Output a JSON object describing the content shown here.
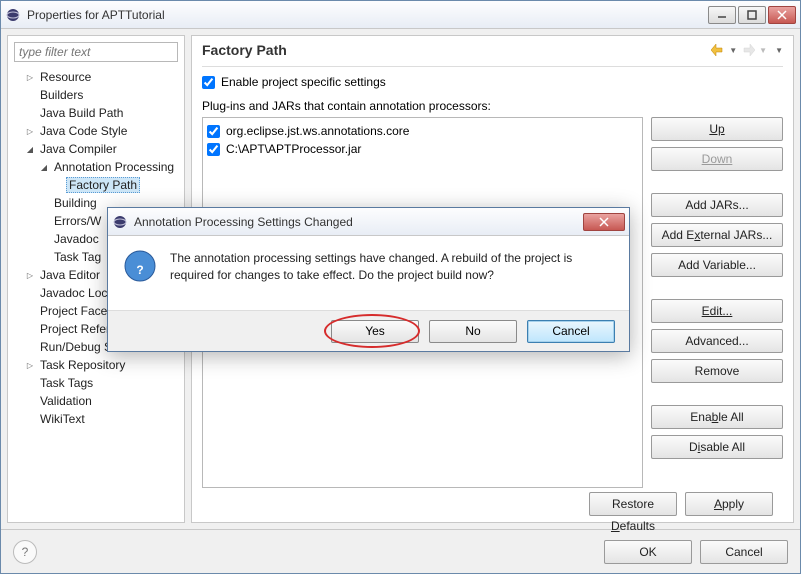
{
  "window": {
    "title": "Properties for APTTutorial",
    "filter_placeholder": "type filter text"
  },
  "tree": [
    {
      "label": "Resource",
      "depth": 1,
      "twisty": "▷"
    },
    {
      "label": "Builders",
      "depth": 1,
      "twisty": ""
    },
    {
      "label": "Java Build Path",
      "depth": 1,
      "twisty": ""
    },
    {
      "label": "Java Code Style",
      "depth": 1,
      "twisty": "▷"
    },
    {
      "label": "Java Compiler",
      "depth": 1,
      "twisty": "▲"
    },
    {
      "label": "Annotation Processing",
      "depth": 2,
      "twisty": "▲"
    },
    {
      "label": "Factory Path",
      "depth": 3,
      "twisty": "",
      "selected": true
    },
    {
      "label": "Building",
      "depth": 2,
      "twisty": ""
    },
    {
      "label": "Errors/W",
      "depth": 2,
      "twisty": ""
    },
    {
      "label": "Javadoc",
      "depth": 2,
      "twisty": ""
    },
    {
      "label": "Task Tag",
      "depth": 2,
      "twisty": ""
    },
    {
      "label": "Java Editor",
      "depth": 1,
      "twisty": "▷"
    },
    {
      "label": "Javadoc Loca",
      "depth": 1,
      "twisty": ""
    },
    {
      "label": "Project Facet",
      "depth": 1,
      "twisty": ""
    },
    {
      "label": "Project Refer",
      "depth": 1,
      "twisty": ""
    },
    {
      "label": "Run/Debug S",
      "depth": 1,
      "twisty": ""
    },
    {
      "label": "Task Repository",
      "depth": 1,
      "twisty": "▷"
    },
    {
      "label": "Task Tags",
      "depth": 1,
      "twisty": ""
    },
    {
      "label": "Validation",
      "depth": 1,
      "twisty": ""
    },
    {
      "label": "WikiText",
      "depth": 1,
      "twisty": ""
    }
  ],
  "main": {
    "title": "Factory Path",
    "enable_label": "Enable project specific settings",
    "list_label": "Plug-ins and JARs that contain annotation processors:",
    "items": [
      {
        "label": "org.eclipse.jst.ws.annotations.core"
      },
      {
        "label": "C:\\APT\\APTProcessor.jar"
      }
    ],
    "buttons": {
      "up": "Up",
      "down": "Down",
      "add_jars": "Add JARs...",
      "add_ext": "Add External JARs...",
      "add_var": "Add Variable...",
      "edit": "Edit...",
      "advanced": "Advanced...",
      "remove": "Remove",
      "enable_all": "Enable All",
      "disable_all": "Disable All"
    },
    "restore": "Restore Defaults",
    "apply": "Apply"
  },
  "footer": {
    "ok": "OK",
    "cancel": "Cancel"
  },
  "dialog": {
    "title": "Annotation Processing Settings Changed",
    "message": "The annotation processing settings have changed. A rebuild of the project is required for changes to take effect. Do the project build now?",
    "yes": "Yes",
    "no": "No",
    "cancel": "Cancel"
  }
}
